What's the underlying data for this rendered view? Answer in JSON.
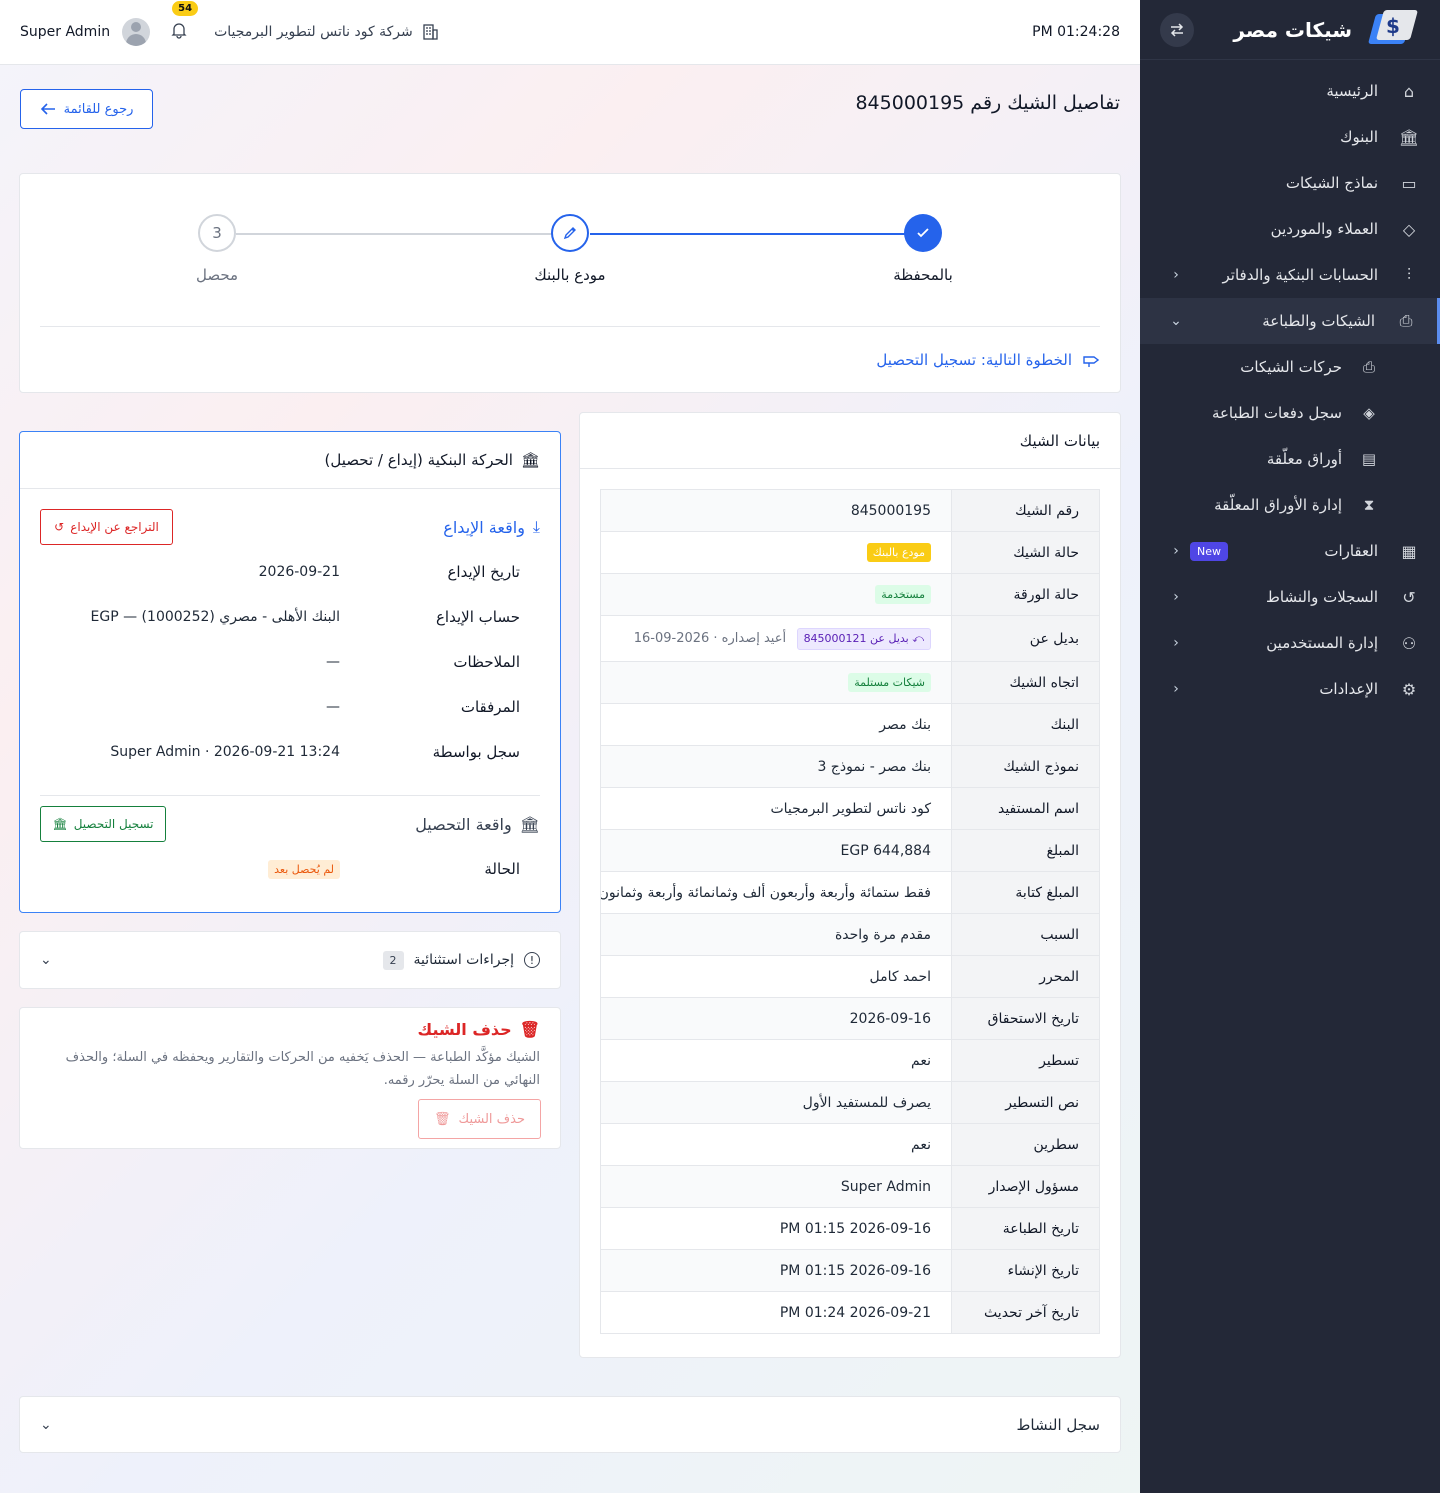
{
  "sidebar": {
    "title": "شيكات مصر",
    "items": [
      {
        "label": "الرئيسية",
        "icon": "home-icon"
      },
      {
        "label": "البنوك",
        "icon": "bank-icon"
      },
      {
        "label": "نماذج الشيكات",
        "icon": "banknote-icon"
      },
      {
        "label": "العملاء والموردين",
        "icon": "handshake-icon"
      },
      {
        "label": "الحسابات البنكية والدفاتر",
        "icon": "sliders-icon"
      },
      {
        "label": "الشيكات والطباعة",
        "icon": "printer-icon"
      }
    ],
    "sub_items": [
      {
        "label": "حركات الشيكات",
        "icon": "printer-icon"
      },
      {
        "label": "سجل دفعات الطباعة",
        "icon": "layers-icon"
      },
      {
        "label": "أوراق معلّقة",
        "icon": "file-icon"
      },
      {
        "label": "إدارة الأوراق المعلّقة",
        "icon": "hourglass-icon"
      }
    ],
    "items2": [
      {
        "label": "العقارات",
        "icon": "building-icon",
        "badge": "New"
      },
      {
        "label": "السجلات والنشاط",
        "icon": "history-icon"
      },
      {
        "label": "إدارة المستخدمين",
        "icon": "users-icon"
      },
      {
        "label": "الإعدادات",
        "icon": "gear-icon"
      }
    ]
  },
  "topbar": {
    "time": "PM 01:24:28",
    "company": "شركة كود ناتس لتطوير البرمجيات",
    "notifications": "54",
    "user": "Super Admin"
  },
  "page": {
    "title": "تفاصيل الشيك رقم 845000195",
    "back": "رجوع للقائمة"
  },
  "stepper": {
    "steps": [
      {
        "label": "بالمحفظة",
        "state": "done"
      },
      {
        "label": "مودع بالبنك",
        "state": "current"
      },
      {
        "label": "محصل",
        "state": "pending",
        "number": "3"
      }
    ],
    "next": "الخطوة التالية: تسجيل التحصيل"
  },
  "check_data": {
    "title": "بيانات الشيك",
    "rows": {
      "number": {
        "k": "رقم الشيك",
        "v": "845000195"
      },
      "status": {
        "k": "حالة الشيك",
        "v": "مودع بالبنك"
      },
      "paper": {
        "k": "حالة الورقة",
        "v": "مستخدمة"
      },
      "replacement": {
        "k": "بديل عن",
        "pill": "بديل عن 845000121",
        "note": "أعيد إصداره · 2026-09-16"
      },
      "direction": {
        "k": "اتجاه الشيك",
        "v": "شيكات مستلمة"
      },
      "bank": {
        "k": "البنك",
        "v": "بنك مصر"
      },
      "template": {
        "k": "نموذج الشيك",
        "v": "بنك مصر - نموذج 3"
      },
      "beneficiary": {
        "k": "اسم المستفيد",
        "v": "كود ناتس لتطوير البرمجيات"
      },
      "amount": {
        "k": "المبلغ",
        "v": "EGP 644,884"
      },
      "amount_words": {
        "k": "المبلغ كتابة",
        "v": "فقط ستمائة وأربعة وأربعون ألف وثمانمائة وأربعة وثمانون جنيه"
      },
      "reason": {
        "k": "السبب",
        "v": "مقدم مرة واحدة"
      },
      "writer": {
        "k": "المحرر",
        "v": "احمد كامل"
      },
      "due": {
        "k": "تاريخ الاستحقاق",
        "v": "2026-09-16"
      },
      "crossed": {
        "k": "تسطير",
        "v": "نعم"
      },
      "cross_text": {
        "k": "نص التسطير",
        "v": "يصرف للمستفيد الأول"
      },
      "two_lines": {
        "k": "سطرين",
        "v": "نعم"
      },
      "issuer": {
        "k": "مسؤول الإصدار",
        "v": "Super Admin"
      },
      "printed": {
        "k": "تاريخ الطباعة",
        "v": "PM 01:15 2026-09-16"
      },
      "created": {
        "k": "تاريخ الإنشاء",
        "v": "PM 01:15 2026-09-16"
      },
      "updated": {
        "k": "تاريخ آخر تحديث",
        "v": "PM 01:24 2026-09-21"
      }
    }
  },
  "bank_movement": {
    "title": "الحركة البنكية (إيداع / تحصيل)",
    "deposit_title": "واقعة الإيداع",
    "undo": "التراجع عن الإيداع",
    "rows": [
      {
        "k": "تاريخ الإيداع",
        "v": "2026-09-21"
      },
      {
        "k": "حساب الإيداع",
        "v": "البنك الأهلى - مصري (1000252) — EGP"
      },
      {
        "k": "الملاحظات",
        "v": "—"
      },
      {
        "k": "المرفقات",
        "v": "—"
      },
      {
        "k": "سجل بواسطة",
        "v": "Super Admin · 2026-09-21 13:24"
      }
    ],
    "collection_title": "واقعة التحصيل",
    "collect_btn": "تسجيل التحصيل",
    "status_k": "الحالة",
    "status_v": "لم يُحصل بعد"
  },
  "exceptional": {
    "title": "إجراءات استثنائية",
    "count": "2"
  },
  "delete": {
    "title": "حذف الشيك",
    "text": "الشيك مؤكَّد الطباعة — الحذف يَخفيه من الحركات والتقارير ويحفظه في السلة؛ والحذف النهائي من السلة يحرّر رقمه.",
    "button": "حذف الشيك"
  },
  "activity": {
    "title": "سجل النشاط"
  },
  "colors": {
    "primary": "#2563eb",
    "sidebar": "#232837",
    "danger": "#dc2626",
    "success": "#15803d",
    "warning": "#facc15"
  }
}
